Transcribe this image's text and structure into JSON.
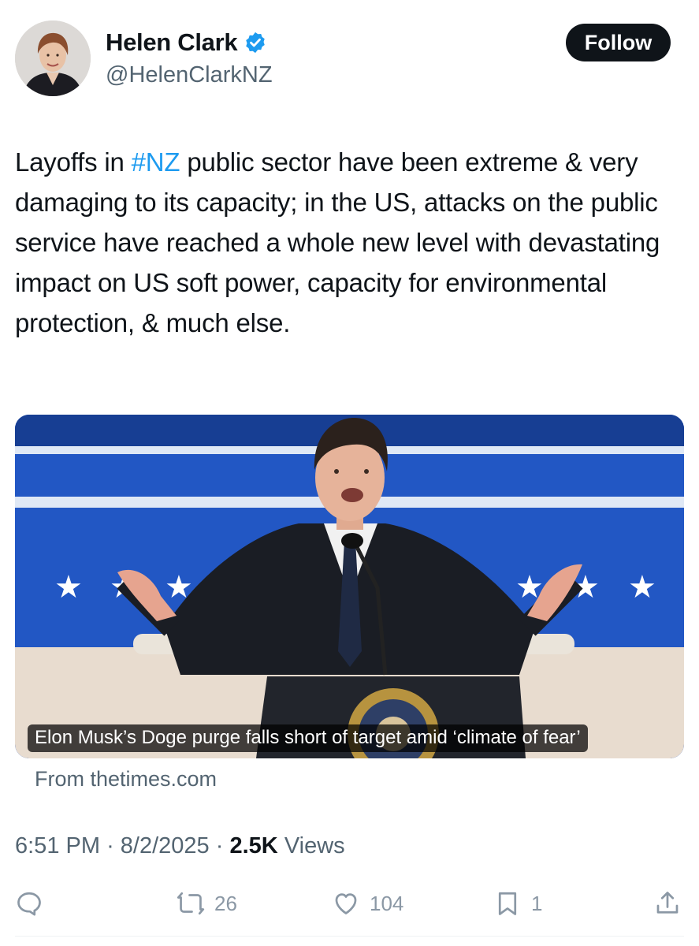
{
  "author": {
    "display_name": "Helen Clark",
    "handle": "@HelenClarkNZ",
    "verified": true,
    "verified_color": "#1d9bf0"
  },
  "follow_label": "Follow",
  "tweet": {
    "text_before": "Layoffs in ",
    "hashtag": "#NZ",
    "text_after": " public sector have been extreme & very damaging to its capacity; in the US, attacks on the public service have reached a whole new level with devastating impact on US soft power, capacity for environmental protection, & much else."
  },
  "link_card": {
    "caption": "Elon Musk’s Doge purge falls short of target amid ‘climate of fear’",
    "source": "From thetimes.com",
    "image_icon": "speaker-at-podium-photo"
  },
  "meta": {
    "time": "6:51 PM",
    "separator": "·",
    "date": "8/2/2025",
    "views_count": "2.5K",
    "views_label": "Views"
  },
  "actions": {
    "reply_icon": "reply-icon",
    "retweet_count": "26",
    "like_count": "104",
    "bookmark_count": "1",
    "share_icon": "share-icon"
  },
  "colors": {
    "text": "#0f1419",
    "secondary": "#536471",
    "link": "#1d9bf0",
    "action_gray": "#8b98a5"
  }
}
